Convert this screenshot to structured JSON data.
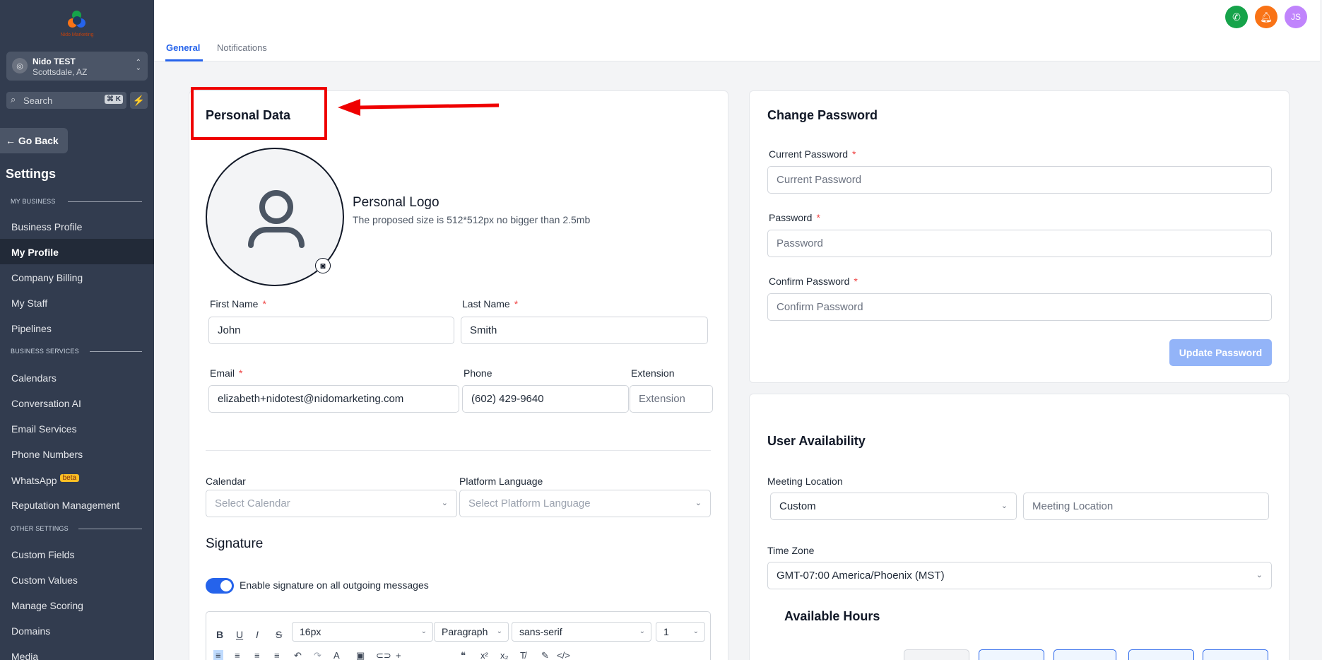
{
  "brand": {
    "logo_text": "Nido Marketing"
  },
  "location": {
    "name": "Nido TEST",
    "city": "Scottsdale, AZ"
  },
  "search": {
    "placeholder": "Search",
    "shortcut": "⌘ K"
  },
  "go_back": "Go Back",
  "settings_title": "Settings",
  "sections": {
    "my_business": "MY BUSINESS",
    "business_services": "BUSINESS SERVICES",
    "other_settings": "OTHER SETTINGS"
  },
  "nav": {
    "business_profile": "Business Profile",
    "my_profile": "My Profile",
    "company_billing": "Company Billing",
    "my_staff": "My Staff",
    "pipelines": "Pipelines",
    "calendars": "Calendars",
    "conversation_ai": "Conversation AI",
    "email_services": "Email Services",
    "phone_numbers": "Phone Numbers",
    "whatsapp": "WhatsApp",
    "whatsapp_badge": "beta",
    "reputation_management": "Reputation Management",
    "custom_fields": "Custom Fields",
    "custom_values": "Custom Values",
    "manage_scoring": "Manage Scoring",
    "domains": "Domains",
    "media": "Media"
  },
  "tabs": {
    "general": "General",
    "notifications": "Notifications"
  },
  "topbar": {
    "avatar_initials": "JS"
  },
  "personal": {
    "title": "Personal Data",
    "logo_title": "Personal Logo",
    "logo_hint": "The proposed size is 512*512px no bigger than 2.5mb",
    "first_name_label": "First Name",
    "first_name": "John",
    "last_name_label": "Last Name",
    "last_name": "Smith",
    "email_label": "Email",
    "email": "elizabeth+nidotest@nidomarketing.com",
    "phone_label": "Phone",
    "phone": "(602) 429-9640",
    "extension_label": "Extension",
    "extension_placeholder": "Extension",
    "calendar_label": "Calendar",
    "calendar_placeholder": "Select Calendar",
    "language_label": "Platform Language",
    "language_placeholder": "Select Platform Language",
    "signature_title": "Signature",
    "signature_toggle_label": "Enable signature on all outgoing messages",
    "editor": {
      "font_size": "16px",
      "block": "Paragraph",
      "font": "sans-serif",
      "line_height": "1"
    }
  },
  "password": {
    "title": "Change Password",
    "current_label": "Current Password",
    "current_placeholder": "Current Password",
    "new_label": "Password",
    "new_placeholder": "Password",
    "confirm_label": "Confirm Password",
    "confirm_placeholder": "Confirm Password",
    "update_button": "Update Password"
  },
  "availability": {
    "title": "User Availability",
    "meeting_location_label": "Meeting Location",
    "meeting_type": "Custom",
    "meeting_location_placeholder": "Meeting Location",
    "timezone_label": "Time Zone",
    "timezone": "GMT-07:00 America/Phoenix (MST)",
    "available_hours_title": "Available Hours"
  },
  "colors": {
    "sidebar": "#323c4f",
    "accent": "#2563eb",
    "phone_button": "#16a34a",
    "bell_button": "#f97316",
    "avatar": "#c084fc",
    "annotation": "#ef0000"
  }
}
